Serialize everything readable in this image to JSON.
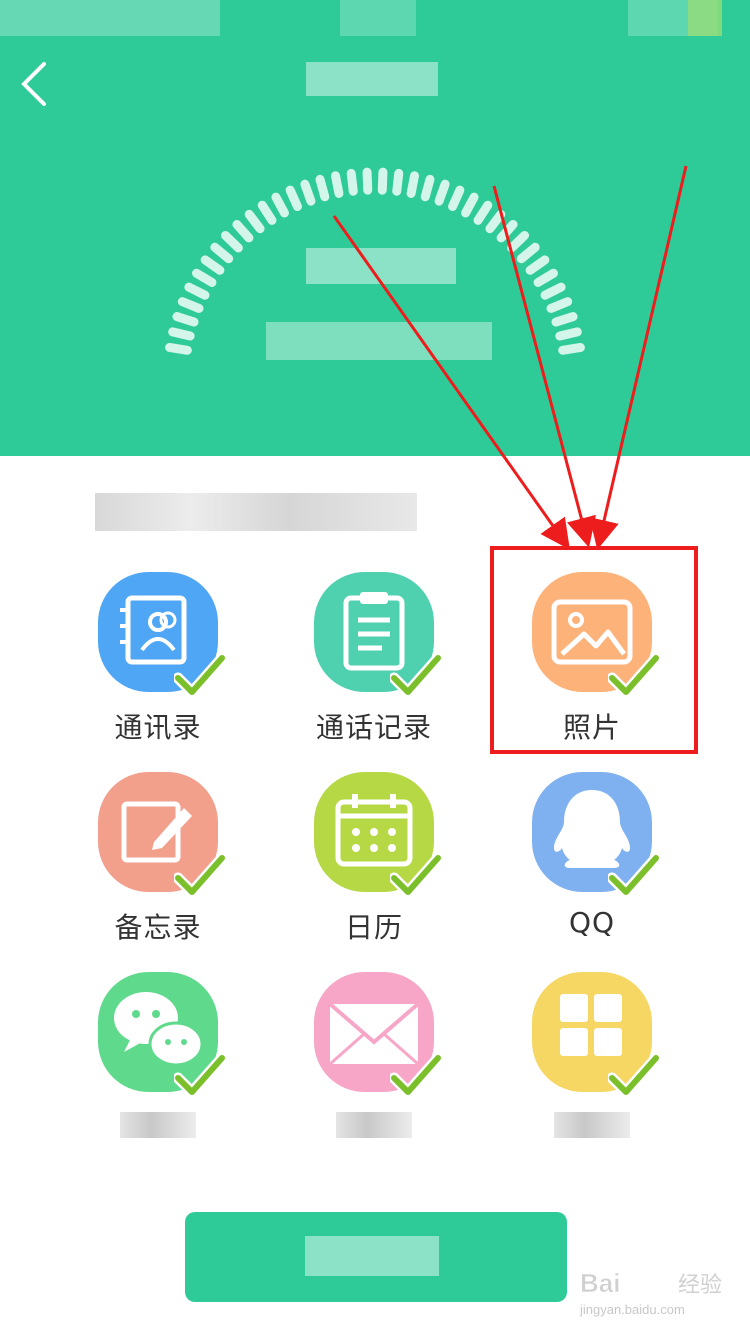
{
  "header": {
    "back_icon": "chevron-left-icon",
    "bg_color": "#2ecb98"
  },
  "grid": {
    "items": [
      {
        "label": "通讯录",
        "icon": "contacts-icon",
        "color": "#4ea6f4"
      },
      {
        "label": "通话记录",
        "icon": "call-log-icon",
        "color": "#4fd1b0"
      },
      {
        "label": "照片",
        "icon": "photo-icon",
        "color": "#fdb27a"
      },
      {
        "label": "备忘录",
        "icon": "memo-icon",
        "color": "#f29f8c"
      },
      {
        "label": "日历",
        "icon": "calendar-icon",
        "color": "#b6d845"
      },
      {
        "label": "QQ",
        "icon": "qq-icon",
        "color": "#7fb1f0"
      },
      {
        "label": "",
        "icon": "wechat-icon",
        "color": "#5fda8c"
      },
      {
        "label": "",
        "icon": "sms-icon",
        "color": "#f7a6c8"
      },
      {
        "label": "",
        "icon": "apps-icon",
        "color": "#f6d763"
      }
    ]
  },
  "check_color": "#7bbf2a",
  "highlight_color": "#ee1d1d",
  "watermark": {
    "brand": "Bai",
    "brand2": "经验",
    "url": "jingyan.baidu.com"
  }
}
